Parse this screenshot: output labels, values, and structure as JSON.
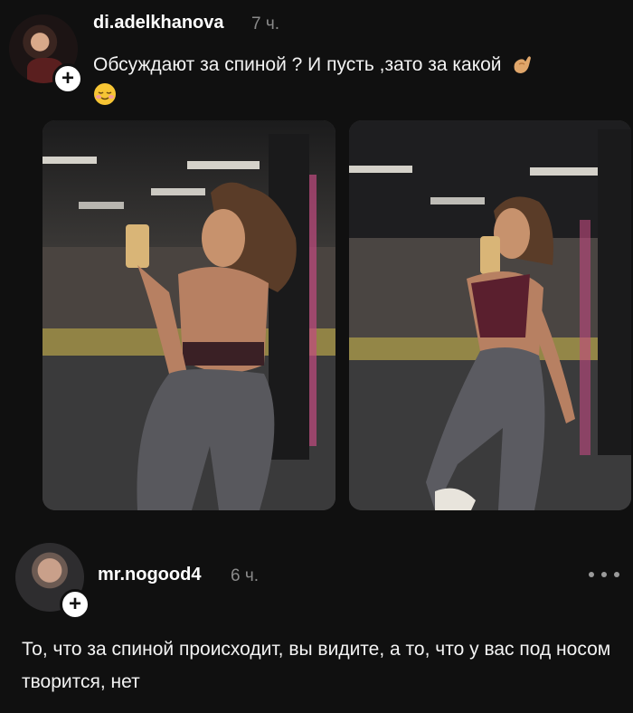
{
  "post": {
    "username": "di.adelkhanova",
    "time": "7 ч.",
    "text": "Обсуждают за спиной ? И пусть ,зато за какой",
    "emojis": [
      "pinching-hand-icon",
      "relieved-face-icon"
    ],
    "follow_icon": "plus-icon",
    "photos": [
      {
        "name": "gym-mirror-selfie-back"
      },
      {
        "name": "gym-mirror-selfie-side"
      }
    ]
  },
  "comment": {
    "username": "mr.nogood4",
    "time": "6 ч.",
    "text": "То, что за спиной происходит, вы видите, а то, что у вас под носом творится, нет",
    "follow_icon": "plus-icon",
    "more_icon": "more-dots-icon"
  },
  "colors": {
    "background": "#101010",
    "text": "#f3f3f3",
    "muted": "#8a8a8a",
    "accent_pink": "#d94a8c"
  }
}
